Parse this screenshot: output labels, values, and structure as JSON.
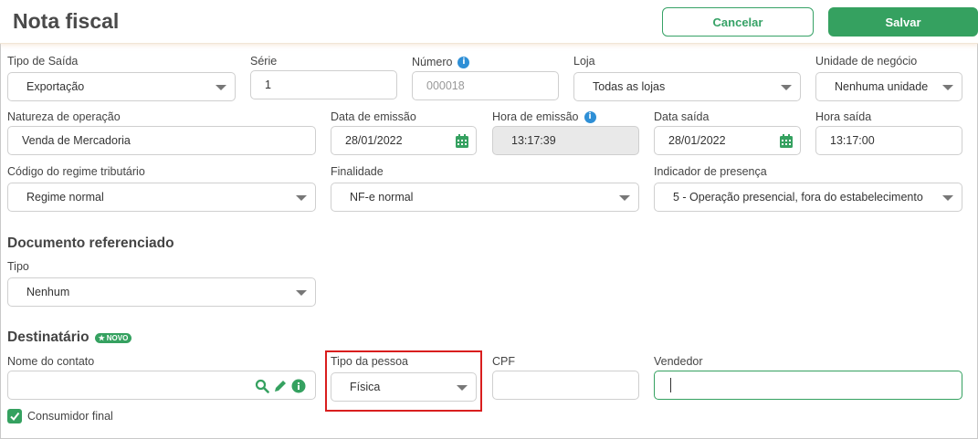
{
  "header": {
    "title": "Nota fiscal",
    "cancel_label": "Cancelar",
    "save_label": "Salvar"
  },
  "row1": {
    "tipo_saida": {
      "label": "Tipo de Saída",
      "value": "Exportação"
    },
    "serie": {
      "label": "Série",
      "value": "1"
    },
    "numero": {
      "label": "Número",
      "placeholder": "000018"
    },
    "loja": {
      "label": "Loja",
      "value": "Todas as lojas"
    },
    "unidade": {
      "label": "Unidade de negócio",
      "value": "Nenhuma unidade"
    }
  },
  "row2": {
    "natureza": {
      "label": "Natureza de operação",
      "value": "Venda de Mercadoria"
    },
    "data_emissao": {
      "label": "Data de emissão",
      "value": "28/01/2022"
    },
    "hora_emissao": {
      "label": "Hora de emissão",
      "value": "13:17:39"
    },
    "data_saida": {
      "label": "Data saída",
      "value": "28/01/2022"
    },
    "hora_saida": {
      "label": "Hora saída",
      "value": "13:17:00"
    }
  },
  "row3": {
    "regime": {
      "label": "Código do regime tributário",
      "value": "Regime normal"
    },
    "finalidade": {
      "label": "Finalidade",
      "value": "NF-e normal"
    },
    "presenca": {
      "label": "Indicador de presença",
      "value": "5 - Operação presencial, fora do estabelecimento"
    }
  },
  "doc_ref": {
    "title": "Documento referenciado",
    "tipo_label": "Tipo",
    "tipo_value": "Nenhum"
  },
  "destinatario": {
    "title": "Destinatário",
    "badge": "NOVO",
    "nome_label": "Nome do contato",
    "nome_value": "",
    "tipo_pessoa_label": "Tipo da pessoa",
    "tipo_pessoa_value": "Física",
    "cpf_label": "CPF",
    "cpf_value": "",
    "vendedor_label": "Vendedor",
    "vendedor_value": "",
    "consumidor_final_label": "Consumidor final",
    "consumidor_final_checked": true
  },
  "colors": {
    "accent": "#35a160",
    "info": "#2e8fd6",
    "highlight": "#d91e1e"
  }
}
